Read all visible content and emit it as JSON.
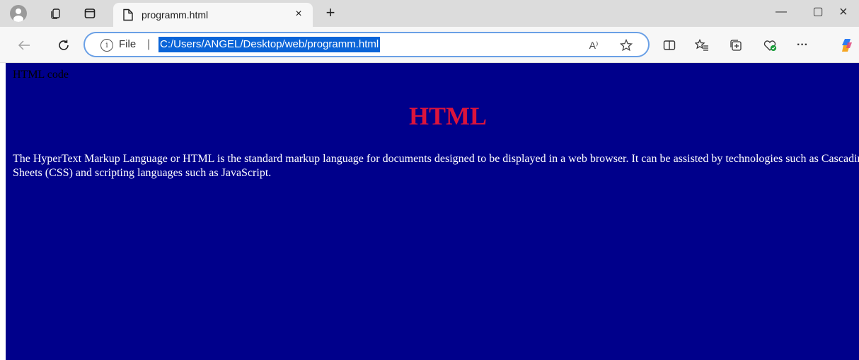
{
  "browser": {
    "tab": {
      "title": "programm.html",
      "close_glyph": "×"
    },
    "new_tab_glyph": "+",
    "window_controls": {
      "minimize": "—",
      "maximize": "▢",
      "close": "×"
    },
    "address": {
      "scheme_label": "File",
      "separator": "|",
      "url": "C:/Users/ANGEL/Desktop/web/programm.html"
    },
    "read_aloud_label": "A⁾",
    "more_label": "···",
    "accent_color": "#0a64d8",
    "icons": [
      "profile-icon",
      "workspaces-icon",
      "tab-actions-icon",
      "page-icon",
      "back-icon",
      "refresh-icon",
      "info-icon",
      "read-aloud-icon",
      "favorite-star-icon",
      "split-screen-icon",
      "favorites-icon",
      "collections-icon",
      "browser-essentials-icon",
      "more-icon",
      "copilot-icon"
    ]
  },
  "page": {
    "background": "#00008b",
    "text_line": "HTML code",
    "heading": "HTML",
    "heading_color": "#dc143c",
    "paragraph": "The HyperText Markup Language or HTML is the standard markup language for documents designed to be displayed in a web browser. It can be assisted by technologies such as Cascading Style Sheets (CSS) and scripting languages such as JavaScript."
  }
}
